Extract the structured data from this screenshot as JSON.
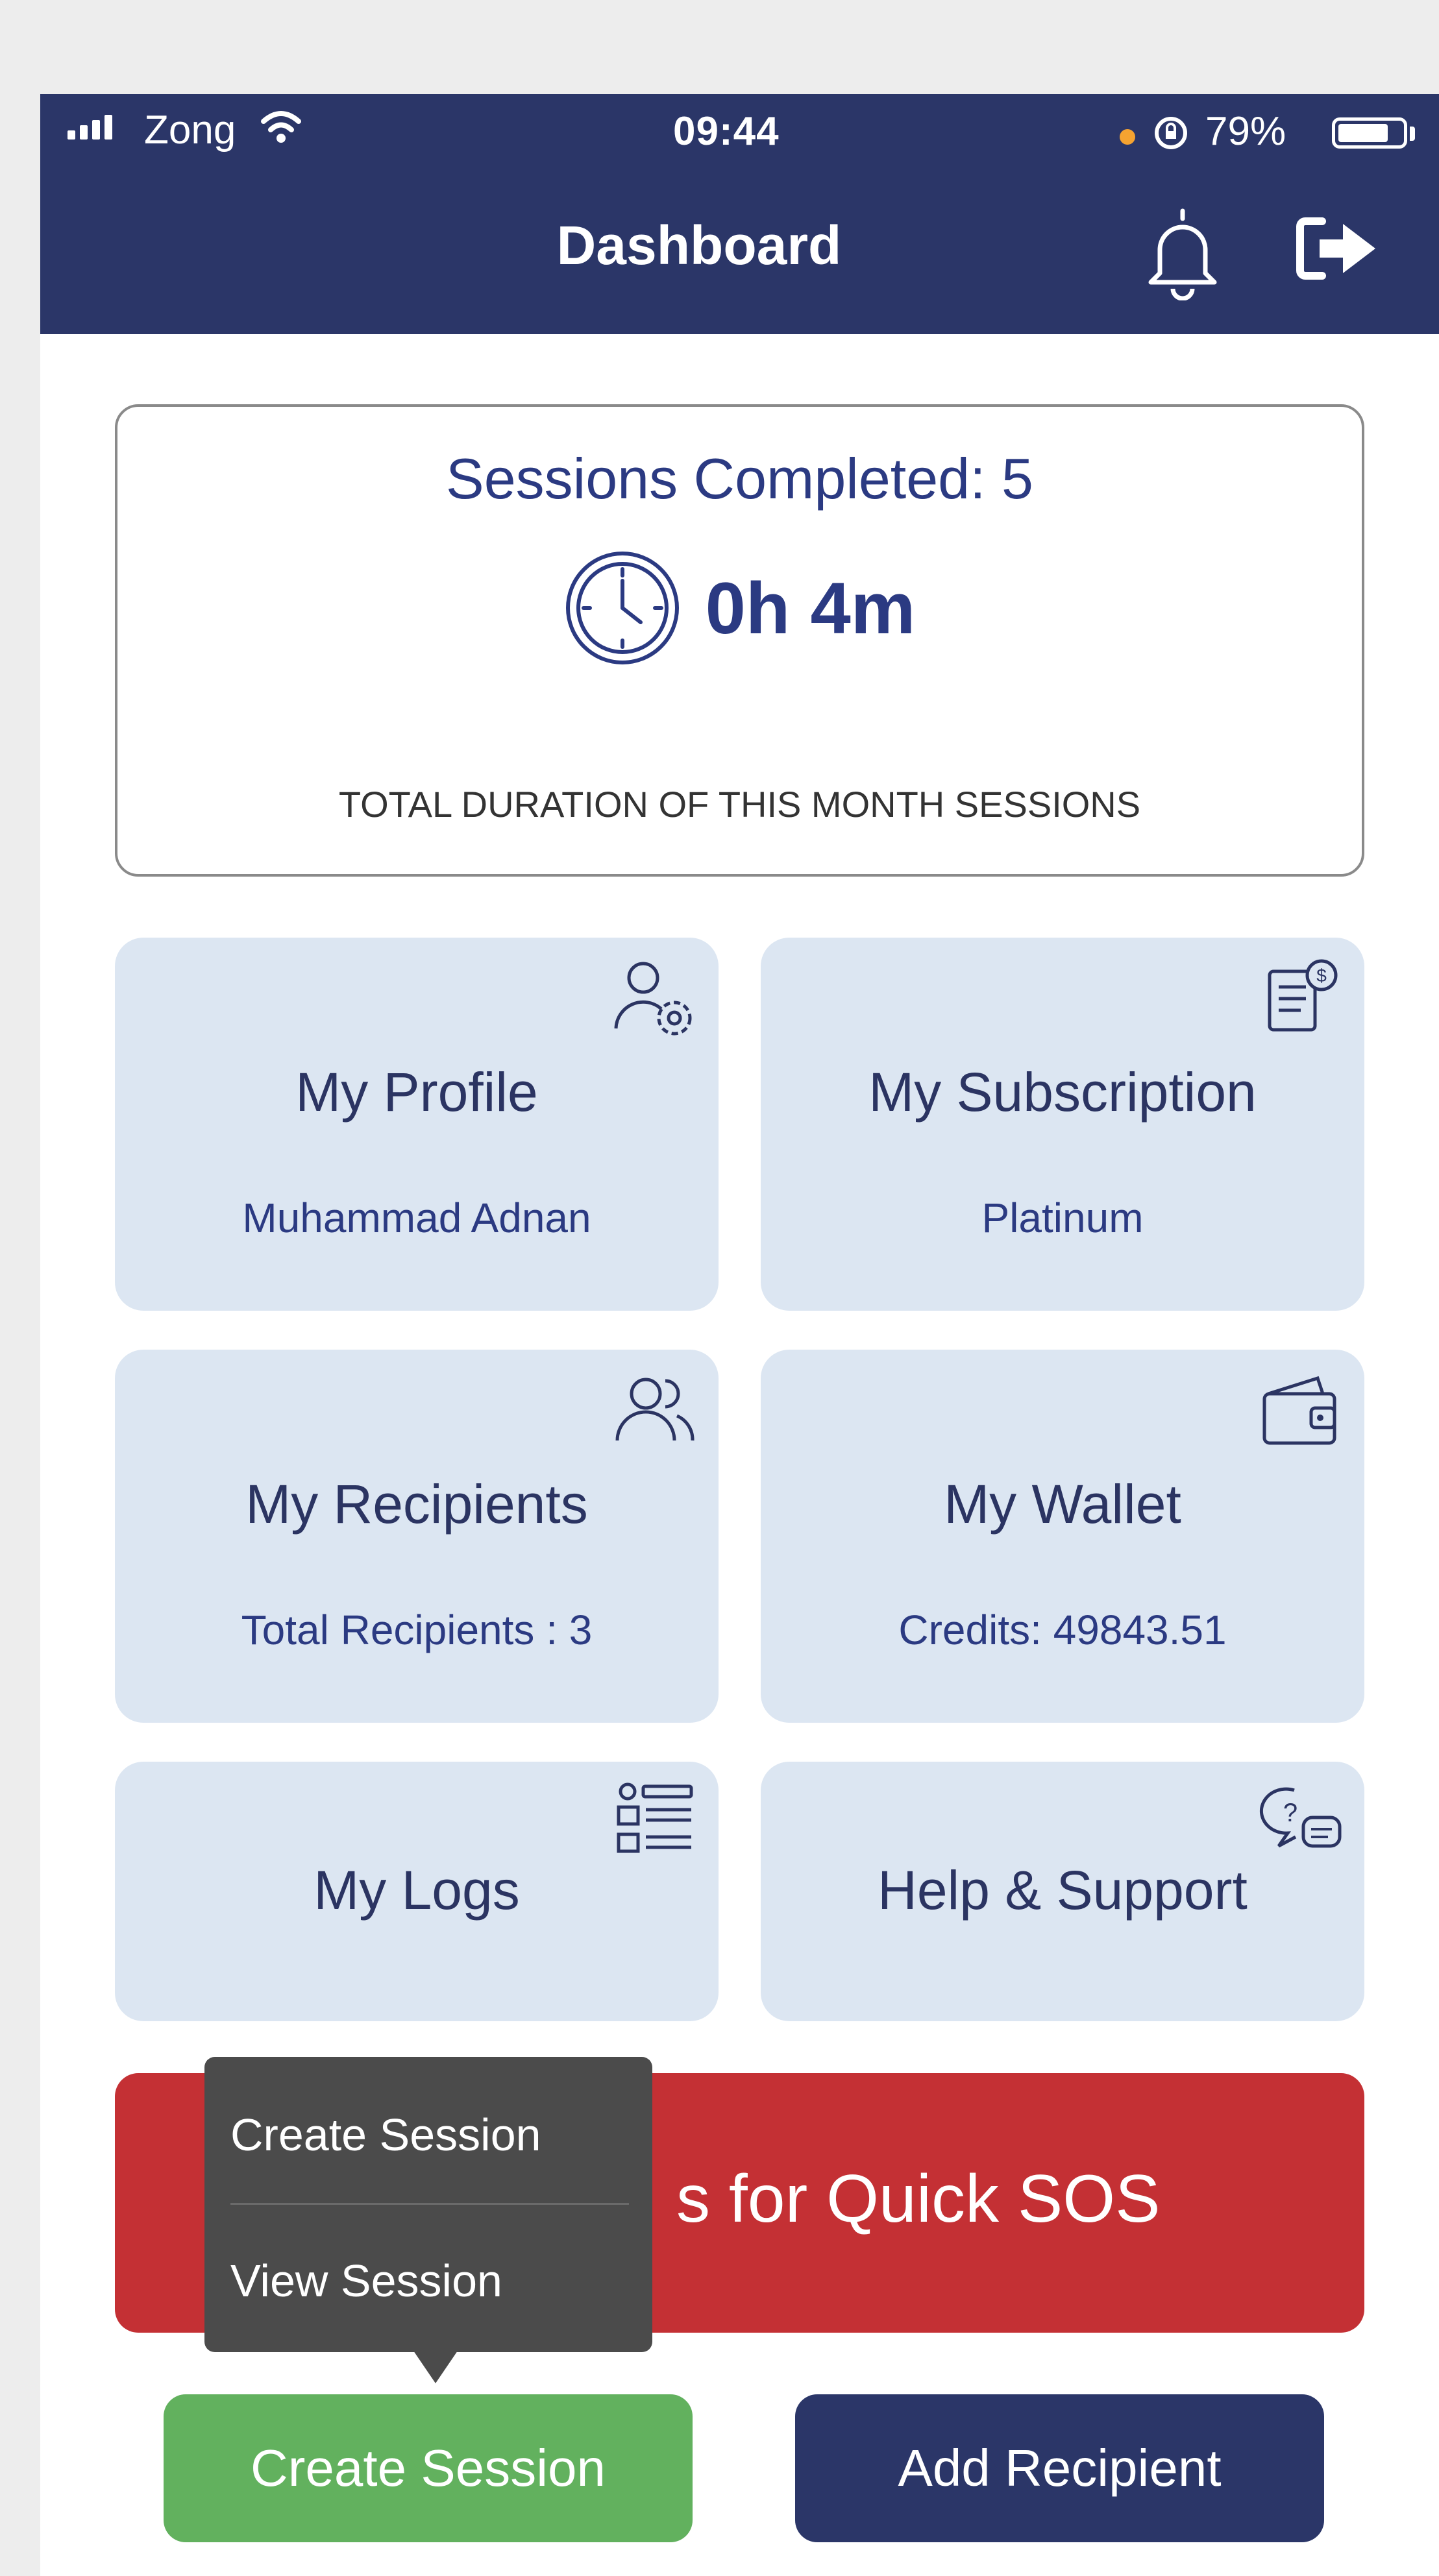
{
  "status_bar": {
    "carrier": "Zong",
    "time": "09:44",
    "battery": "79%"
  },
  "header": {
    "title": "Dashboard",
    "icons": [
      "bell-icon",
      "logout-icon"
    ]
  },
  "summary": {
    "sessions_completed": "Sessions Completed: 5",
    "duration": "0h 4m",
    "caption": "TOTAL DURATION OF THIS MONTH SESSIONS"
  },
  "cards": [
    {
      "title": "My Profile",
      "subtitle": "Muhammad Adnan",
      "icon": "profile-settings-icon"
    },
    {
      "title": "My Subscription",
      "subtitle": "Platinum",
      "icon": "subscription-receipt-icon"
    },
    {
      "title": "My Recipients",
      "subtitle": "Total Recipients : 3",
      "icon": "users-icon"
    },
    {
      "title": "My Wallet",
      "subtitle": "Credits: 49843.51",
      "icon": "wallet-icon"
    },
    {
      "title": "My Logs",
      "icon": "list-icon"
    },
    {
      "title": "Help & Support",
      "icon": "help-chat-icon"
    }
  ],
  "sos_banner": {
    "visible_text": "s for Quick SOS"
  },
  "popup_menu": {
    "items": [
      "Create Session",
      "View Session"
    ]
  },
  "buttons": {
    "create_session": "Create Session",
    "add_recipient": "Add Recipient"
  },
  "colors": {
    "header": "#2b3668",
    "accent_text": "#2b3a82",
    "card_bg": "#dce6f2",
    "sos": "#c43034",
    "create_button": "#62b15e",
    "add_button": "#2b3668",
    "popup": "#4b4b4b",
    "battery_dot": "#f5a331"
  }
}
